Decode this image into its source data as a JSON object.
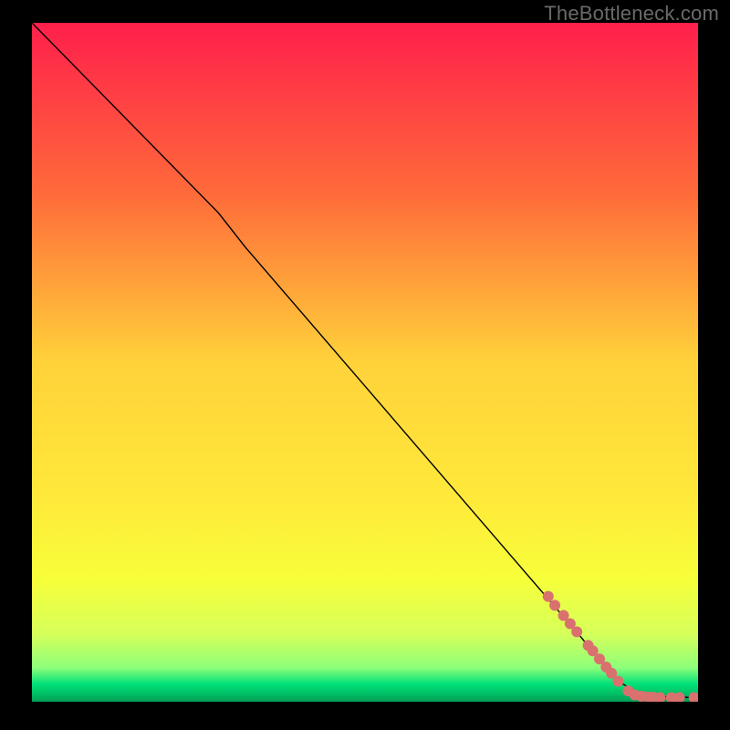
{
  "watermark": "TheBottleneck.com",
  "chart_data": {
    "type": "line",
    "title": "",
    "xlabel": "",
    "ylabel": "",
    "xlim": [
      0,
      100
    ],
    "ylim": [
      0,
      100
    ],
    "background_gradient": {
      "stops": [
        {
          "offset": 0.0,
          "color": "#ff1f4b"
        },
        {
          "offset": 0.25,
          "color": "#ff6a3a"
        },
        {
          "offset": 0.5,
          "color": "#ffd23a"
        },
        {
          "offset": 0.7,
          "color": "#ffe93a"
        },
        {
          "offset": 0.82,
          "color": "#f7ff3a"
        },
        {
          "offset": 0.9,
          "color": "#d6ff5a"
        },
        {
          "offset": 0.95,
          "color": "#8dff7a"
        },
        {
          "offset": 0.974,
          "color": "#00e07a"
        },
        {
          "offset": 0.985,
          "color": "#00c86a"
        },
        {
          "offset": 1.0,
          "color": "#009e55"
        }
      ]
    },
    "line_series": {
      "name": "curve",
      "color": "#000000",
      "width": 1.4,
      "points": [
        {
          "x": 0,
          "y": 100
        },
        {
          "x": 28,
          "y": 72
        },
        {
          "x": 32,
          "y": 67
        },
        {
          "x": 82,
          "y": 10
        },
        {
          "x": 88,
          "y": 3
        },
        {
          "x": 92,
          "y": 0.8
        },
        {
          "x": 100,
          "y": 0.6
        }
      ]
    },
    "scatter_series": {
      "name": "markers",
      "color": "#d9716f",
      "radius": 6,
      "points": [
        {
          "x": 77.5,
          "y": 15.5
        },
        {
          "x": 78.5,
          "y": 14.2
        },
        {
          "x": 79.8,
          "y": 12.7
        },
        {
          "x": 80.8,
          "y": 11.5
        },
        {
          "x": 81.8,
          "y": 10.3
        },
        {
          "x": 83.5,
          "y": 8.3
        },
        {
          "x": 84.2,
          "y": 7.5
        },
        {
          "x": 85.2,
          "y": 6.3
        },
        {
          "x": 86.2,
          "y": 5.1
        },
        {
          "x": 87.0,
          "y": 4.2
        },
        {
          "x": 88.0,
          "y": 3.0
        },
        {
          "x": 89.5,
          "y": 1.6
        },
        {
          "x": 90.5,
          "y": 1.0
        },
        {
          "x": 91.5,
          "y": 0.8
        },
        {
          "x": 92.5,
          "y": 0.7
        },
        {
          "x": 93.3,
          "y": 0.65
        },
        {
          "x": 94.3,
          "y": 0.6
        },
        {
          "x": 96.0,
          "y": 0.6
        },
        {
          "x": 97.2,
          "y": 0.6
        },
        {
          "x": 99.4,
          "y": 0.6
        }
      ]
    }
  }
}
